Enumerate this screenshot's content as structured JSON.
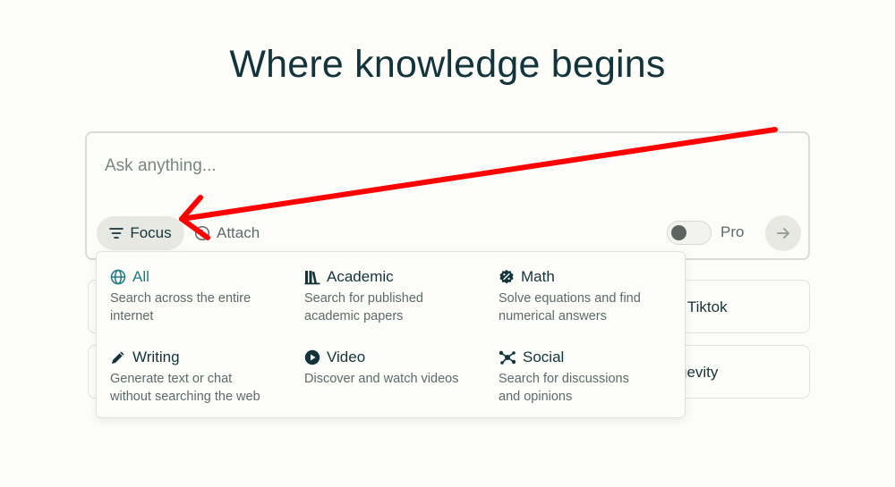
{
  "headline": "Where knowledge begins",
  "search": {
    "placeholder": "Ask anything...",
    "value": "",
    "focus_label": "Focus",
    "attach_label": "Attach",
    "pro_label": "Pro",
    "pro_enabled": false
  },
  "suggestions": [
    {
      "label": "n Tiktok"
    },
    {
      "label": "gevity"
    }
  ],
  "focus_menu": {
    "options": [
      {
        "id": "all",
        "title": "All",
        "desc_line1": "Search across the entire",
        "desc_line2": "internet",
        "icon": "globe-icon",
        "active": true
      },
      {
        "id": "academic",
        "title": "Academic",
        "desc_line1": "Search for published",
        "desc_line2": "academic papers",
        "icon": "books-icon",
        "active": false
      },
      {
        "id": "math",
        "title": "Math",
        "desc_line1": "Solve equations and find",
        "desc_line2": "numerical answers",
        "icon": "percent-badge-icon",
        "active": false
      },
      {
        "id": "writing",
        "title": "Writing",
        "desc_line1": "Generate text or chat",
        "desc_line2": "without searching the web",
        "icon": "pencil-icon",
        "active": false
      },
      {
        "id": "video",
        "title": "Video",
        "desc_line1": "Discover and watch videos",
        "desc_line2": "",
        "icon": "play-circle-icon",
        "active": false
      },
      {
        "id": "social",
        "title": "Social",
        "desc_line1": "Search for discussions",
        "desc_line2": "and opinions",
        "icon": "network-icon",
        "active": false
      }
    ]
  },
  "colors": {
    "background": "#fcfcf9",
    "text": "#13343b",
    "accent": "#1f7b86",
    "muted": "#5d6a6b",
    "annotation_arrow": "#ff0000"
  }
}
